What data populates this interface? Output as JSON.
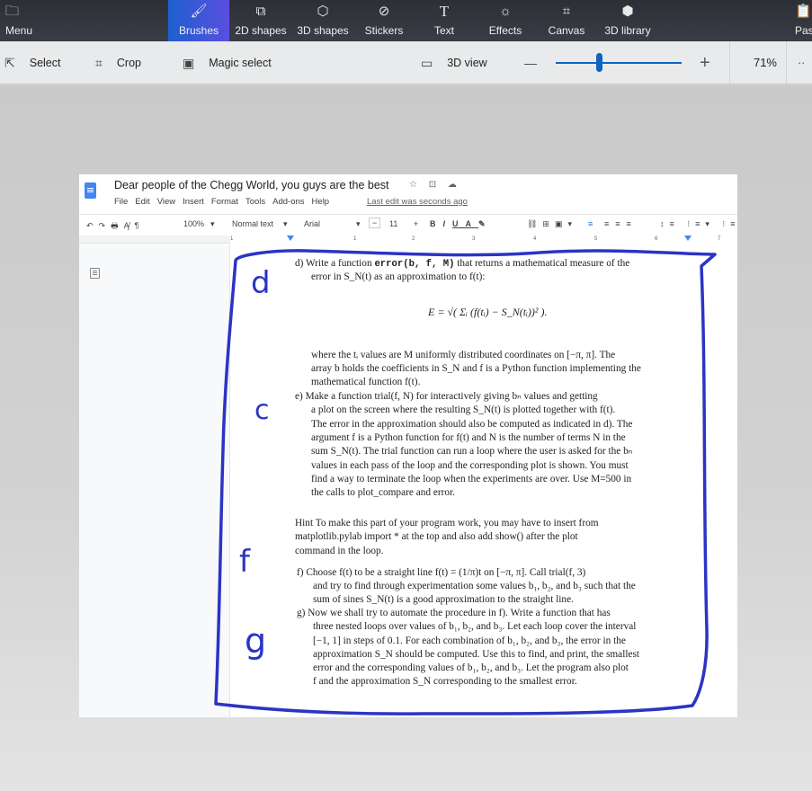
{
  "app": {
    "ribbon": {
      "menu_label": "Menu",
      "tabs": [
        {
          "label": "Brushes",
          "icon": "brush-icon",
          "active": true
        },
        {
          "label": "2D shapes",
          "icon": "2d-shapes-icon",
          "active": false
        },
        {
          "label": "3D shapes",
          "icon": "3d-shapes-icon",
          "active": false
        },
        {
          "label": "Stickers",
          "icon": "stickers-icon",
          "active": false
        },
        {
          "label": "Text",
          "icon": "text-icon",
          "active": false
        },
        {
          "label": "Effects",
          "icon": "effects-icon",
          "active": false
        },
        {
          "label": "Canvas",
          "icon": "canvas-icon",
          "active": false
        },
        {
          "label": "3D library",
          "icon": "3d-library-icon",
          "active": false
        }
      ],
      "paste_label": "Pas"
    },
    "toolbar": {
      "select_label": "Select",
      "crop_label": "Crop",
      "magic_select_label": "Magic select",
      "view3d_label": "3D view",
      "zoom_minus": "—",
      "zoom_plus": "+",
      "zoom_value": "71%",
      "zoom_slider_fraction": 0.33,
      "more": "··",
      "accent_color": "#0b63c4"
    }
  },
  "screenshot": {
    "docs": {
      "title": "Dear people of the Chegg World, you guys are the best",
      "title_icons": "☆ ⊡ ☁",
      "menus": [
        "File",
        "Edit",
        "View",
        "Insert",
        "Format",
        "Tools",
        "Add-ons",
        "Help"
      ],
      "last_edit": "Last edit was seconds ago",
      "toolbar": {
        "zoom": "100%",
        "style": "Normal text",
        "font": "Arial",
        "font_size": "11",
        "minus": "−",
        "plus": "+"
      },
      "ruler_marks": [
        "1",
        "1",
        "2",
        "3",
        "4",
        "5",
        "6",
        "7"
      ]
    },
    "content": {
      "d_line1_a": "d)  Write a function ",
      "d_line1_code": "error(b, f, M)",
      "d_line1_b": " that returns a mathematical measure of the",
      "d_line2": "error in S_N(t) as an approximation to f(t):",
      "formula": "E = √( Σᵢ (f(tᵢ) − S_N(tᵢ))² ).",
      "where_lines": [
        "where the tᵢ values are M uniformly distributed coordinates on [−π, π]. The",
        "array b holds the coefficients in S_N and f is a Python function implementing the",
        "mathematical function f(t)."
      ],
      "e_lines": [
        "e)  Make a function trial(f, N) for interactively giving bₙ values and getting",
        "a plot on the screen where the resulting S_N(t) is plotted together with f(t).",
        "The error in the approximation should also be computed as indicated in d). The",
        "argument f is a Python function for f(t) and N is the number of terms N in the",
        "sum S_N(t). The trial function can run a loop where the user is asked for the bₙ",
        "values in each pass of the loop and the corresponding plot is shown. You must",
        "find a way to terminate the loop when the experiments are over. Use M=500 in",
        "the calls to plot_compare and error."
      ],
      "hint_lines": [
        "Hint To make this part of your program work, you may have to insert from",
        "matplotlib.pylab import * at the top and also add show() after the plot",
        "command in the loop."
      ],
      "f_lines": [
        "f)  Choose f(t) to be a straight line f(t) = (1/π)t on [−π, π]. Call trial(f, 3)",
        "and try to find through experimentation some values b₁, b₂, and b₃ such that the",
        "sum of sines S_N(t) is a good approximation to the straight line."
      ],
      "g_lines": [
        "g)  Now we shall try to automate the procedure in f). Write a function that has",
        "three nested loops over values of b₁, b₂, and b₃. Let each loop cover the interval",
        "[−1, 1] in steps of 0.1. For each combination of b₁, b₂, and b₃, the error in the",
        "approximation S_N should be computed. Use this to find, and print, the smallest",
        "error and the corresponding values of b₁, b₂, and b₃. Let the program also plot",
        "f and the approximation S_N corresponding to the smallest error."
      ]
    },
    "annotations": {
      "letters": [
        "d",
        "c",
        "f",
        "g"
      ],
      "stroke_color": "#2b34c4"
    }
  }
}
